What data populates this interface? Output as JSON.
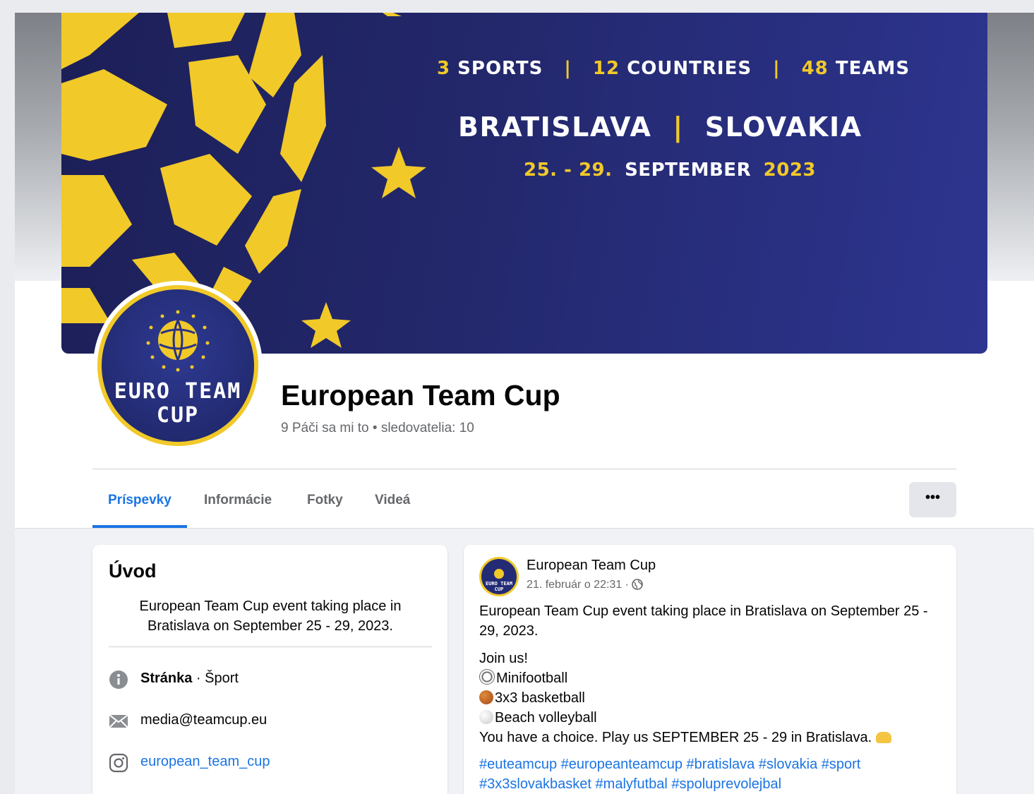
{
  "cover": {
    "line1": {
      "sports_num": "3",
      "sports_label": "SPORTS",
      "countries_num": "12",
      "countries_label": "COUNTRIES",
      "teams_num": "48",
      "teams_label": "TEAMS",
      "separator": "|"
    },
    "line2": {
      "city": "BRATISLAVA",
      "country": "SLOVAKIA",
      "separator": "|"
    },
    "line3": {
      "dates": "25. - 29.",
      "month": "SEPTEMBER",
      "year": "2023"
    },
    "colors": {
      "accent": "#f1c929",
      "navy": "#23286c"
    }
  },
  "profile": {
    "logo_line1": "EURO TEAM",
    "logo_line2": "CUP"
  },
  "page": {
    "name": "European Team Cup",
    "stats": "9 Páči sa mi to • sledovatelia: 10"
  },
  "tabs": [
    {
      "label": "Príspevky",
      "active": true
    },
    {
      "label": "Informácie",
      "active": false
    },
    {
      "label": "Fotky",
      "active": false
    },
    {
      "label": "Videá",
      "active": false
    }
  ],
  "more_button": {
    "label": "•••"
  },
  "intro": {
    "title": "Úvod",
    "description": "European Team Cup event taking place in Bratislava on September 25 - 29, 2023.",
    "category_label": "Stránka",
    "category_value": " · Šport",
    "email": "media@teamcup.eu",
    "instagram": "european_team_cup",
    "icons": [
      "info-icon",
      "mail-icon",
      "instagram-icon"
    ]
  },
  "post": {
    "author": "European Team Cup",
    "timestamp": "21. február o 22:31 · ",
    "avatar_text": "EURO TEAM CUP",
    "paragraph1": "European Team Cup event taking place in Bratislava on September 25 - 29, 2023.",
    "join": "Join us!",
    "sports": [
      {
        "icon": "soccer-ball-icon",
        "label": "Minifootball"
      },
      {
        "icon": "basketball-icon",
        "label": "3x3 basketball"
      },
      {
        "icon": "volleyball-icon",
        "label": "Beach volleyball"
      }
    ],
    "closing": "You have a choice. Play us SEPTEMBER 25 - 29 in Bratislava.",
    "hashtags_line1": "#euteamcup #europeanteamcup #bratislava #slovakia #sport",
    "hashtags_line2": "#3x3slovakbasket #malyfutbal #spoluprevolejbal"
  }
}
